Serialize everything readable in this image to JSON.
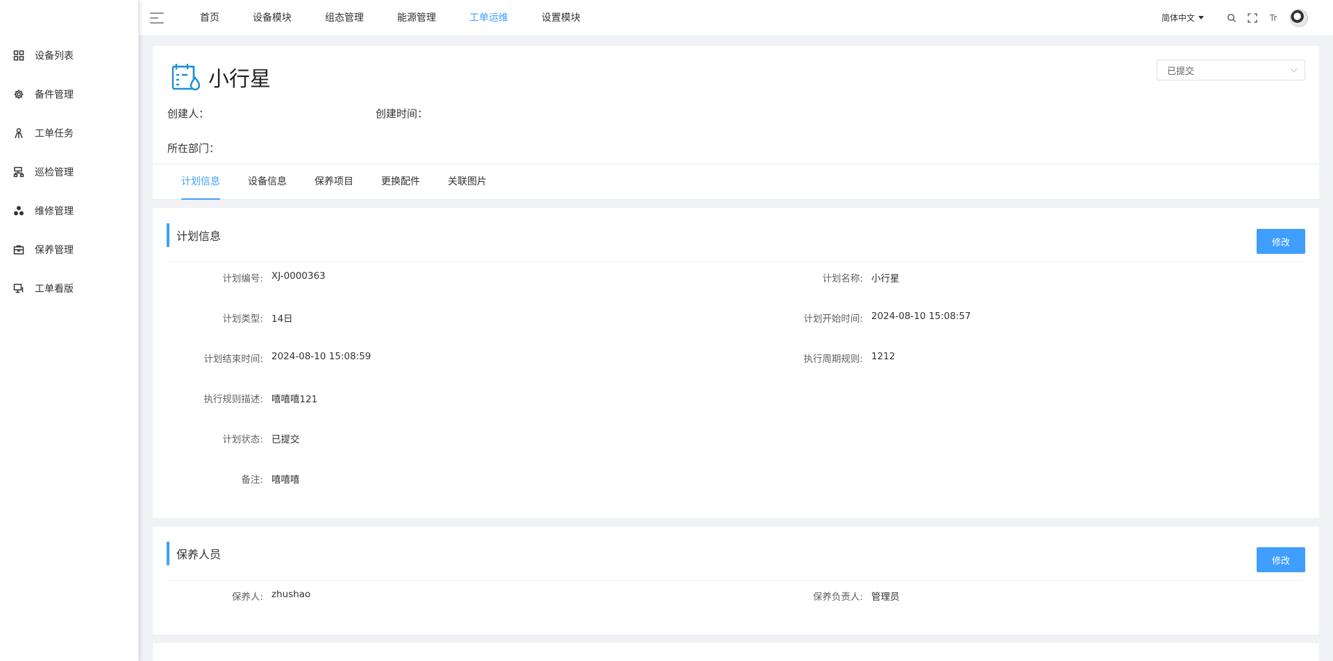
{
  "sidebar": {
    "items": [
      {
        "label": "设备列表",
        "icon": "grid-icon"
      },
      {
        "label": "备件管理",
        "icon": "gear-icon"
      },
      {
        "label": "工单任务",
        "icon": "person-icon"
      },
      {
        "label": "巡检管理",
        "icon": "sitemap-icon"
      },
      {
        "label": "维修管理",
        "icon": "cluster-icon"
      },
      {
        "label": "保养管理",
        "icon": "briefcase-icon"
      },
      {
        "label": "工单看版",
        "icon": "monitor-icon"
      }
    ]
  },
  "topnav": {
    "items": [
      "首页",
      "设备模块",
      "组态管理",
      "能源管理",
      "工单运维",
      "设置模块"
    ],
    "active": "工单运维",
    "language": "简体中文",
    "font_size_icon_label": "Tr"
  },
  "header": {
    "title": "小行星",
    "status_value": "已提交",
    "creator_label": "创建人：",
    "creator_value": "",
    "created_time_label": "创建时间：",
    "created_time_value": "",
    "department_label": "所在部门：",
    "department_value": "",
    "tabs": [
      "计划信息",
      "设备信息",
      "保养项目",
      "更换配件",
      "关联图片"
    ],
    "active_tab": "计划信息"
  },
  "plan_info": {
    "title": "计划信息",
    "edit_label": "修改",
    "fields": [
      {
        "label": "计划编号:",
        "value": "XJ-0000363"
      },
      {
        "label": "计划名称:",
        "value": "小行星"
      },
      {
        "label": "计划类型:",
        "value": "14日"
      },
      {
        "label": "计划开始时间:",
        "value": "2024-08-10 15:08:57"
      },
      {
        "label": "计划结束时间:",
        "value": "2024-08-10 15:08:59"
      },
      {
        "label": "执行周期规则:",
        "value": "1212"
      },
      {
        "label": "执行规则描述:",
        "value": "嘻嘻嘻121"
      },
      {
        "label": "",
        "value": ""
      },
      {
        "label": "计划状态:",
        "value": "已提交"
      },
      {
        "label": "",
        "value": ""
      },
      {
        "label": "备注:",
        "value": "嘻嘻嘻"
      }
    ]
  },
  "maintenance_staff": {
    "title": "保养人员",
    "edit_label": "修改",
    "fields": [
      {
        "label": "保养人:",
        "value": "zhushao"
      },
      {
        "label": "保养负责人:",
        "value": "管理员"
      }
    ]
  },
  "colors": {
    "accent": "#409eff",
    "title_icon": "#1a8fd8",
    "background": "#f0f2f5"
  }
}
